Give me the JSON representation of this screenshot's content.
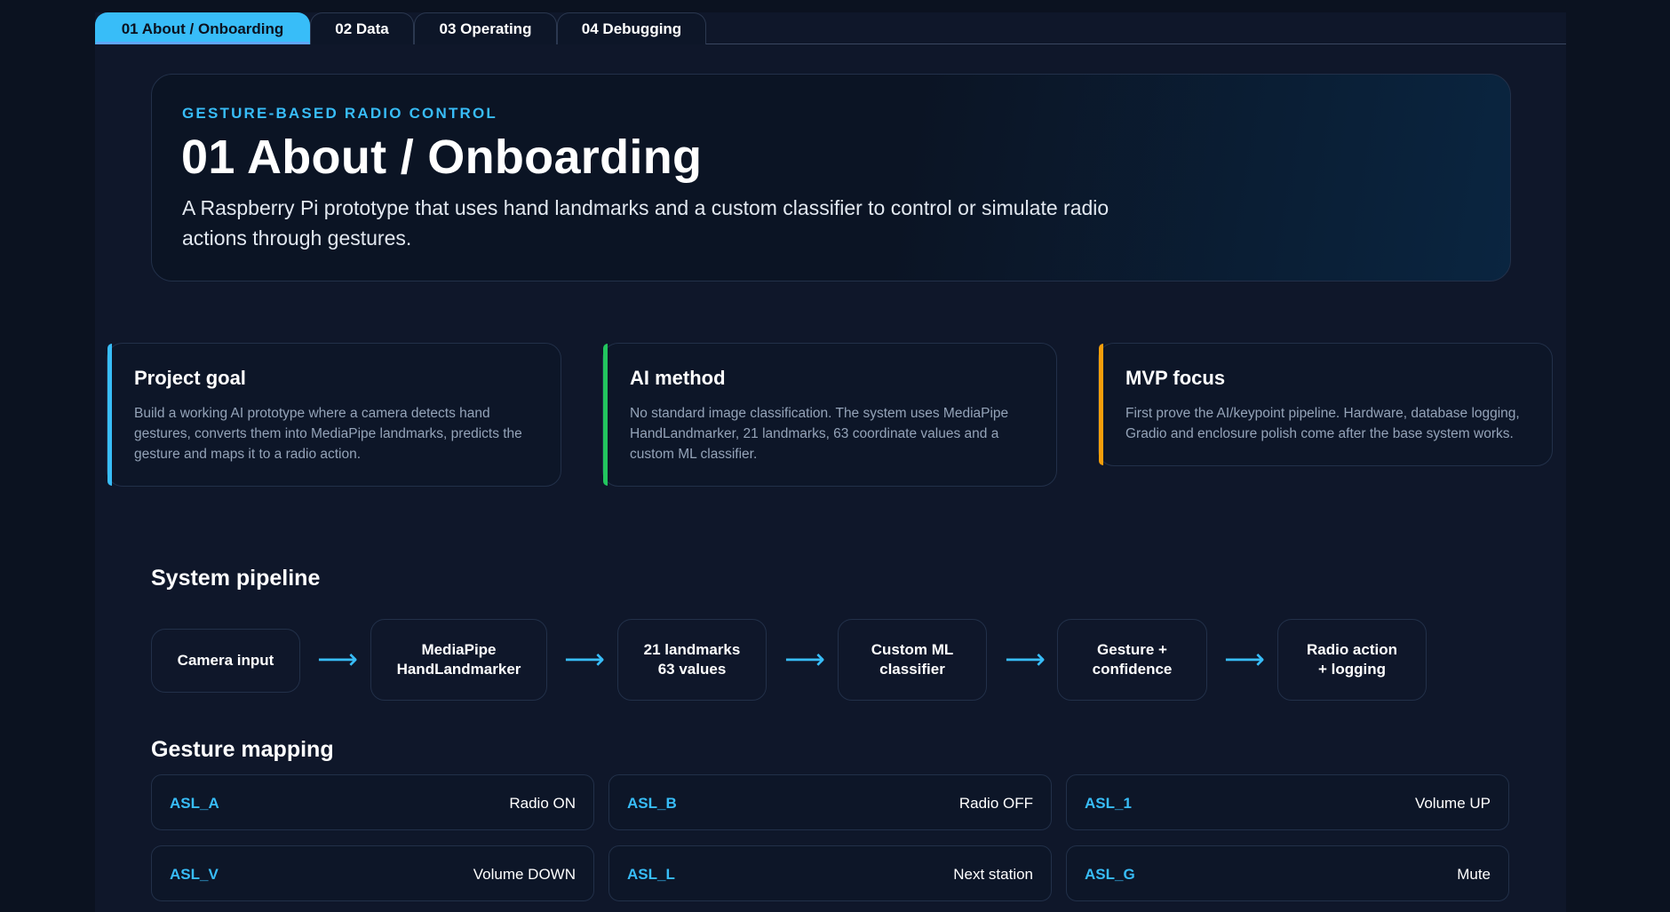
{
  "tabs": [
    {
      "label": "01 About / Onboarding",
      "active": true
    },
    {
      "label": "02 Data",
      "active": false
    },
    {
      "label": "03 Operating",
      "active": false
    },
    {
      "label": "04 Debugging",
      "active": false
    }
  ],
  "hero": {
    "eyebrow": "GESTURE-BASED RADIO CONTROL",
    "title": "01 About / Onboarding",
    "description": "A Raspberry Pi prototype that uses hand landmarks and a custom classifier to control or simulate radio actions through gestures."
  },
  "cards": [
    {
      "title": "Project goal",
      "body": "Build a working AI prototype where a camera detects hand gestures, converts them into MediaPipe landmarks, predicts the gesture and maps it to a radio action.",
      "accent": "#38bdf8"
    },
    {
      "title": "AI method",
      "body": "No standard image classification. The system uses MediaPipe HandLandmarker, 21 landmarks, 63 coordinate values and a custom ML classifier.",
      "accent": "#22c55e"
    },
    {
      "title": "MVP focus",
      "body": "First prove the AI/keypoint pipeline. Hardware, database logging, Gradio and enclosure polish come after the base system works.",
      "accent": "#f59e0b"
    }
  ],
  "pipeline": {
    "title": "System pipeline",
    "steps": [
      {
        "line1": "Camera input",
        "line2": ""
      },
      {
        "line1": "MediaPipe",
        "line2": "HandLandmarker"
      },
      {
        "line1": "21 landmarks",
        "line2": "63 values"
      },
      {
        "line1": "Custom ML",
        "line2": "classifier"
      },
      {
        "line1": "Gesture +",
        "line2": "confidence"
      },
      {
        "line1": "Radio action",
        "line2": "+ logging"
      }
    ],
    "arrow": "⟶"
  },
  "mapping": {
    "title": "Gesture mapping",
    "items": [
      {
        "code": "ASL_A",
        "action": "Radio ON"
      },
      {
        "code": "ASL_B",
        "action": "Radio OFF"
      },
      {
        "code": "ASL_1",
        "action": "Volume UP"
      },
      {
        "code": "ASL_V",
        "action": "Volume DOWN"
      },
      {
        "code": "ASL_L",
        "action": "Next station"
      },
      {
        "code": "ASL_G",
        "action": "Mute"
      }
    ]
  }
}
